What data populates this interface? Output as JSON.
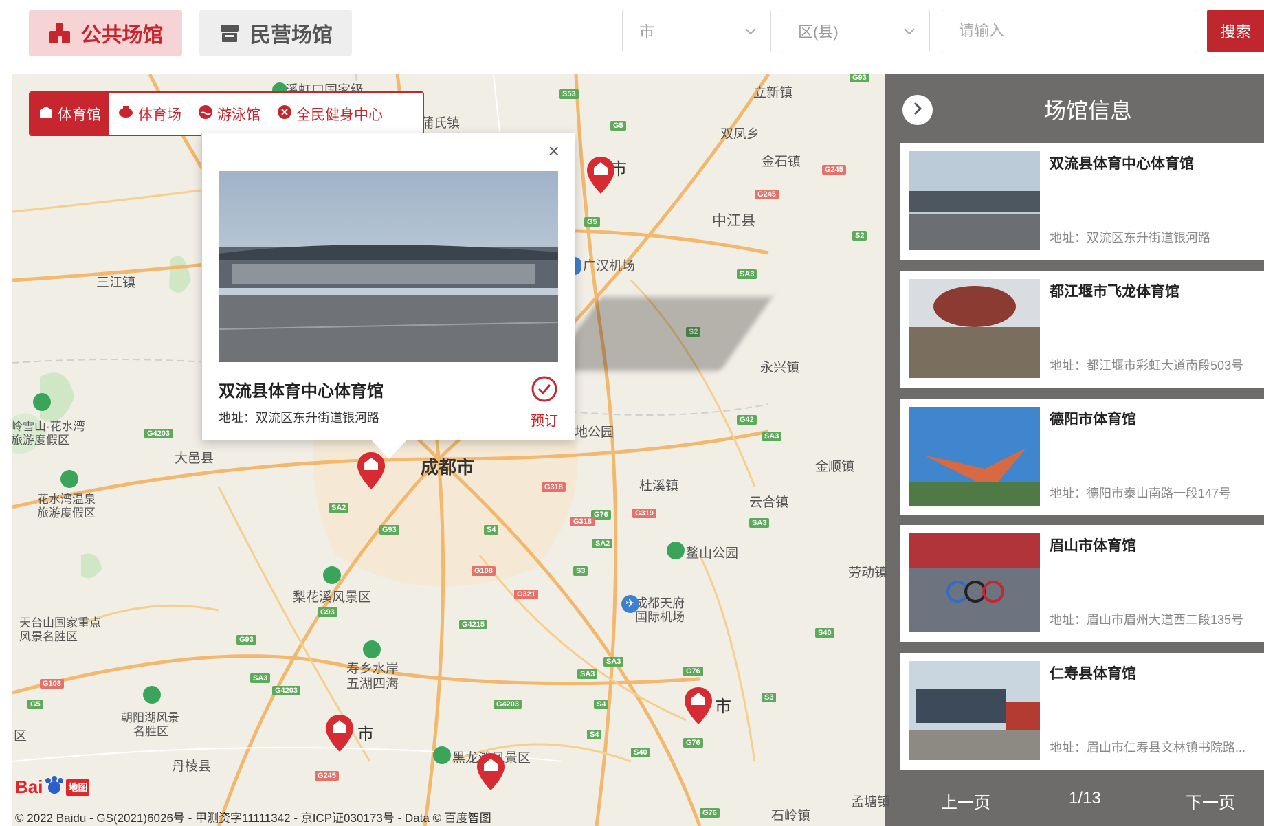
{
  "tabs": {
    "public": "公共场馆",
    "private": "民营场馆"
  },
  "filters": {
    "city_placeholder": "市",
    "district_placeholder": "区(县)",
    "search_placeholder": "请输入",
    "search_button": "搜索"
  },
  "categories": [
    {
      "label": "体育馆",
      "active": true
    },
    {
      "label": "体育场",
      "active": false
    },
    {
      "label": "游泳馆",
      "active": false
    },
    {
      "label": "全民健身中心",
      "active": false
    }
  ],
  "popup": {
    "close": "×",
    "title": "双流县体育中心体育馆",
    "address": "地址：双流区东升街道银河路",
    "book": "预订"
  },
  "side": {
    "title": "场馆信息",
    "venues": [
      {
        "name": "双流县体育中心体育馆",
        "address": "地址：双流区东升街道银河路"
      },
      {
        "name": "都江堰市飞龙体育馆",
        "address": "地址：都江堰市彩虹大道南段503号"
      },
      {
        "name": "德阳市体育馆",
        "address": "地址：德阳市泰山南路一段147号"
      },
      {
        "name": "眉山市体育馆",
        "address": "地址：眉山市眉州大道西二段135号"
      },
      {
        "name": "仁寿县体育馆",
        "address": "地址：眉山市仁寿县文林镇书院路..."
      }
    ],
    "prev": "上一页",
    "page": "1/13",
    "next": "下一页"
  },
  "map": {
    "labels": [
      {
        "text": "龙溪虹口国家级",
        "cls": ""
      },
      {
        "text": "立新镇",
        "cls": ""
      },
      {
        "text": "双凤乡",
        "cls": ""
      },
      {
        "text": "金石镇",
        "cls": ""
      },
      {
        "text": "中江县",
        "cls": ""
      },
      {
        "text": "三江镇",
        "cls": ""
      },
      {
        "text": "广汉机场",
        "cls": ""
      },
      {
        "text": "永兴镇",
        "cls": ""
      },
      {
        "text": "岭雪山·花水湾",
        "cls": ""
      },
      {
        "text": "旅游度假区",
        "cls": ""
      },
      {
        "text": "大邑县",
        "cls": ""
      },
      {
        "text": "成都市",
        "cls": "big"
      },
      {
        "text": "金顺镇",
        "cls": ""
      },
      {
        "text": "花水湾温泉",
        "cls": ""
      },
      {
        "text": "旅游度假区",
        "cls": ""
      },
      {
        "text": "杜溪镇",
        "cls": ""
      },
      {
        "text": "云合镇",
        "cls": ""
      },
      {
        "text": "鳌山公园",
        "cls": ""
      },
      {
        "text": "梨花溪风景区",
        "cls": ""
      },
      {
        "text": "劳动镇",
        "cls": ""
      },
      {
        "text": "天台山国家重点",
        "cls": ""
      },
      {
        "text": "风景名胜区",
        "cls": ""
      },
      {
        "text": "成都天府",
        "cls": ""
      },
      {
        "text": "国际机场",
        "cls": ""
      },
      {
        "text": "寿乡水岸",
        "cls": ""
      },
      {
        "text": "五湖四海",
        "cls": ""
      },
      {
        "text": "朝阳湖风景",
        "cls": ""
      },
      {
        "text": "名胜区",
        "cls": ""
      },
      {
        "text": "丹棱县",
        "cls": ""
      },
      {
        "text": "黑龙滩风景区",
        "cls": ""
      },
      {
        "text": "孟塘镇",
        "cls": ""
      },
      {
        "text": "石岭镇",
        "cls": ""
      },
      {
        "text": "市",
        "cls": ""
      },
      {
        "text": "市",
        "cls": ""
      },
      {
        "text": "市",
        "cls": ""
      },
      {
        "text": "地公园",
        "cls": ""
      },
      {
        "text": "蒲氏镇",
        "cls": ""
      },
      {
        "text": "区",
        "cls": ""
      }
    ],
    "badges": [
      {
        "text": "S53",
        "cls": "s"
      },
      {
        "text": "G5",
        "cls": "s"
      },
      {
        "text": "G245",
        "cls": "g"
      },
      {
        "text": "G245",
        "cls": "g"
      },
      {
        "text": "G5",
        "cls": "s"
      },
      {
        "text": "S2",
        "cls": "s"
      },
      {
        "text": "SA3",
        "cls": "s"
      },
      {
        "text": "S2",
        "cls": "s"
      },
      {
        "text": "G42",
        "cls": "s"
      },
      {
        "text": "SA3",
        "cls": "s"
      },
      {
        "text": "G4203",
        "cls": "s"
      },
      {
        "text": "G318",
        "cls": "g"
      },
      {
        "text": "G76",
        "cls": "s"
      },
      {
        "text": "G319",
        "cls": "g"
      },
      {
        "text": "G318",
        "cls": "g"
      },
      {
        "text": "SA2",
        "cls": "s"
      },
      {
        "text": "G93",
        "cls": "s"
      },
      {
        "text": "S4",
        "cls": "s"
      },
      {
        "text": "SA2",
        "cls": "s"
      },
      {
        "text": "SA3",
        "cls": "s"
      },
      {
        "text": "G108",
        "cls": "g"
      },
      {
        "text": "S3",
        "cls": "s"
      },
      {
        "text": "G321",
        "cls": "g"
      },
      {
        "text": "G93",
        "cls": "s"
      },
      {
        "text": "G4215",
        "cls": "s"
      },
      {
        "text": "S40",
        "cls": "s"
      },
      {
        "text": "G93",
        "cls": "s"
      },
      {
        "text": "SA3",
        "cls": "s"
      },
      {
        "text": "G108",
        "cls": "g"
      },
      {
        "text": "SA3",
        "cls": "s"
      },
      {
        "text": "G4203",
        "cls": "s"
      },
      {
        "text": "SA3",
        "cls": "s"
      },
      {
        "text": "G76",
        "cls": "s"
      },
      {
        "text": "G5",
        "cls": "s"
      },
      {
        "text": "G4203",
        "cls": "s"
      },
      {
        "text": "S4",
        "cls": "s"
      },
      {
        "text": "S3",
        "cls": "s"
      },
      {
        "text": "S4",
        "cls": "s"
      },
      {
        "text": "S40",
        "cls": "s"
      },
      {
        "text": "G76",
        "cls": "s"
      },
      {
        "text": "G245",
        "cls": "g"
      },
      {
        "text": "G76",
        "cls": "s"
      },
      {
        "text": "G93",
        "cls": "s"
      }
    ],
    "copyright": "© 2022 Baidu - GS(2021)6026号 - 甲测资字11111342 - 京ICP证030173号 - Data © 百度智图",
    "logo_text": "Bai",
    "logo_sub": "地图"
  },
  "colors": {
    "accent": "#c8262e",
    "panel": "#5a5a5a"
  }
}
